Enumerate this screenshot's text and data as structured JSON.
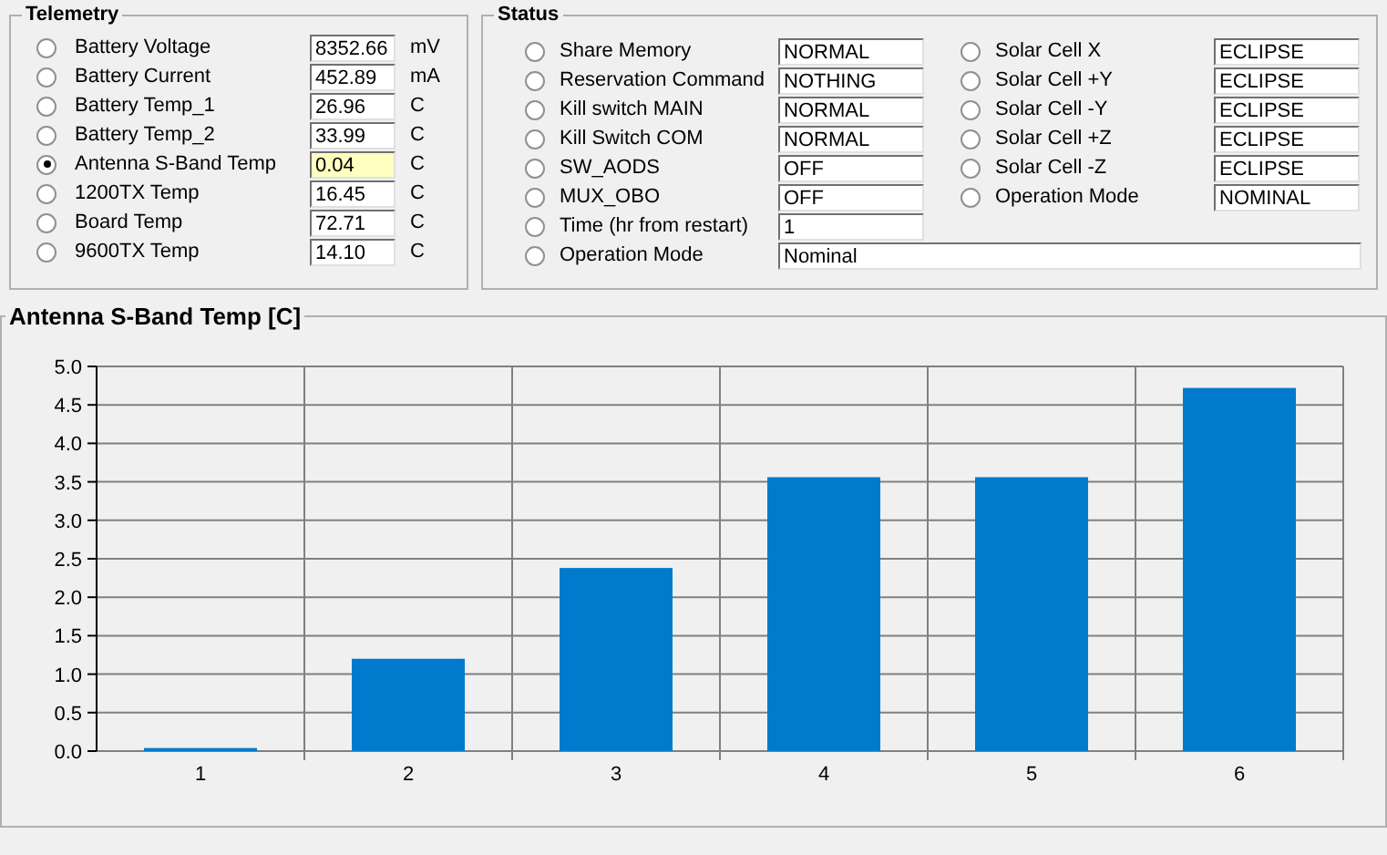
{
  "telemetry": {
    "title": "Telemetry",
    "rows": [
      {
        "label": "Battery Voltage",
        "value": "8352.66",
        "unit": "mV",
        "selected": false,
        "highlighted": false
      },
      {
        "label": "Battery Current",
        "value": "452.89",
        "unit": "mA",
        "selected": false,
        "highlighted": false
      },
      {
        "label": "Battery Temp_1",
        "value": "26.96",
        "unit": "C",
        "selected": false,
        "highlighted": false
      },
      {
        "label": "Battery  Temp_2",
        "value": "33.99",
        "unit": "C",
        "selected": false,
        "highlighted": false
      },
      {
        "label": "Antenna S-Band Temp",
        "value": "0.04",
        "unit": "C",
        "selected": true,
        "highlighted": true
      },
      {
        "label": "1200TX Temp",
        "value": "16.45",
        "unit": "C",
        "selected": false,
        "highlighted": false
      },
      {
        "label": "Board Temp",
        "value": "72.71",
        "unit": "C",
        "selected": false,
        "highlighted": false
      },
      {
        "label": "9600TX Temp",
        "value": "14.10",
        "unit": "C",
        "selected": false,
        "highlighted": false
      }
    ]
  },
  "status": {
    "title": "Status",
    "left": [
      {
        "label": "Share Memory",
        "value": "NORMAL",
        "selected": false
      },
      {
        "label": "Reservation Command",
        "value": "NOTHING",
        "selected": false
      },
      {
        "label": "Kill switch MAIN",
        "value": "NORMAL",
        "selected": false
      },
      {
        "label": "Kill Switch COM",
        "value": "NORMAL",
        "selected": false
      },
      {
        "label": "SW_AODS",
        "value": "OFF",
        "selected": false
      },
      {
        "label": "MUX_OBO",
        "value": "OFF",
        "selected": false
      },
      {
        "label": "Time (hr from restart)",
        "value": "1",
        "selected": false
      }
    ],
    "right": [
      {
        "label": "Solar Cell X",
        "value": "ECLIPSE",
        "selected": false
      },
      {
        "label": "Solar Cell +Y",
        "value": "ECLIPSE",
        "selected": false
      },
      {
        "label": "Solar Cell -Y",
        "value": "ECLIPSE",
        "selected": false
      },
      {
        "label": "Solar Cell +Z",
        "value": "ECLIPSE",
        "selected": false
      },
      {
        "label": "Solar Cell -Z",
        "value": "ECLIPSE",
        "selected": false
      },
      {
        "label": "Operation Mode",
        "value": "NOMINAL",
        "selected": false
      }
    ],
    "mode": {
      "label": "Operation Mode",
      "value": "Nominal",
      "selected": false
    }
  },
  "chart": {
    "title": "Antenna S-Band Temp [C]",
    "chart_data": {
      "type": "bar",
      "categories": [
        "1",
        "2",
        "3",
        "4",
        "5",
        "6"
      ],
      "values": [
        0.04,
        1.2,
        2.38,
        3.56,
        3.56,
        4.72
      ],
      "grid": true,
      "ylim": [
        0,
        5
      ],
      "yticks": [
        {
          "value": 0,
          "label": "0.0"
        },
        {
          "value": 0.5,
          "label": "0.5"
        },
        {
          "value": 1,
          "label": "1.0"
        },
        {
          "value": 1.5,
          "label": "1.5"
        },
        {
          "value": 2,
          "label": "2.0"
        },
        {
          "value": 2.5,
          "label": "2.5"
        },
        {
          "value": 3,
          "label": "3.0"
        },
        {
          "value": 3.5,
          "label": "3.5"
        },
        {
          "value": 4,
          "label": "4.0"
        },
        {
          "value": 4.5,
          "label": "4.5"
        },
        {
          "value": 5,
          "label": "5.0"
        }
      ]
    }
  }
}
